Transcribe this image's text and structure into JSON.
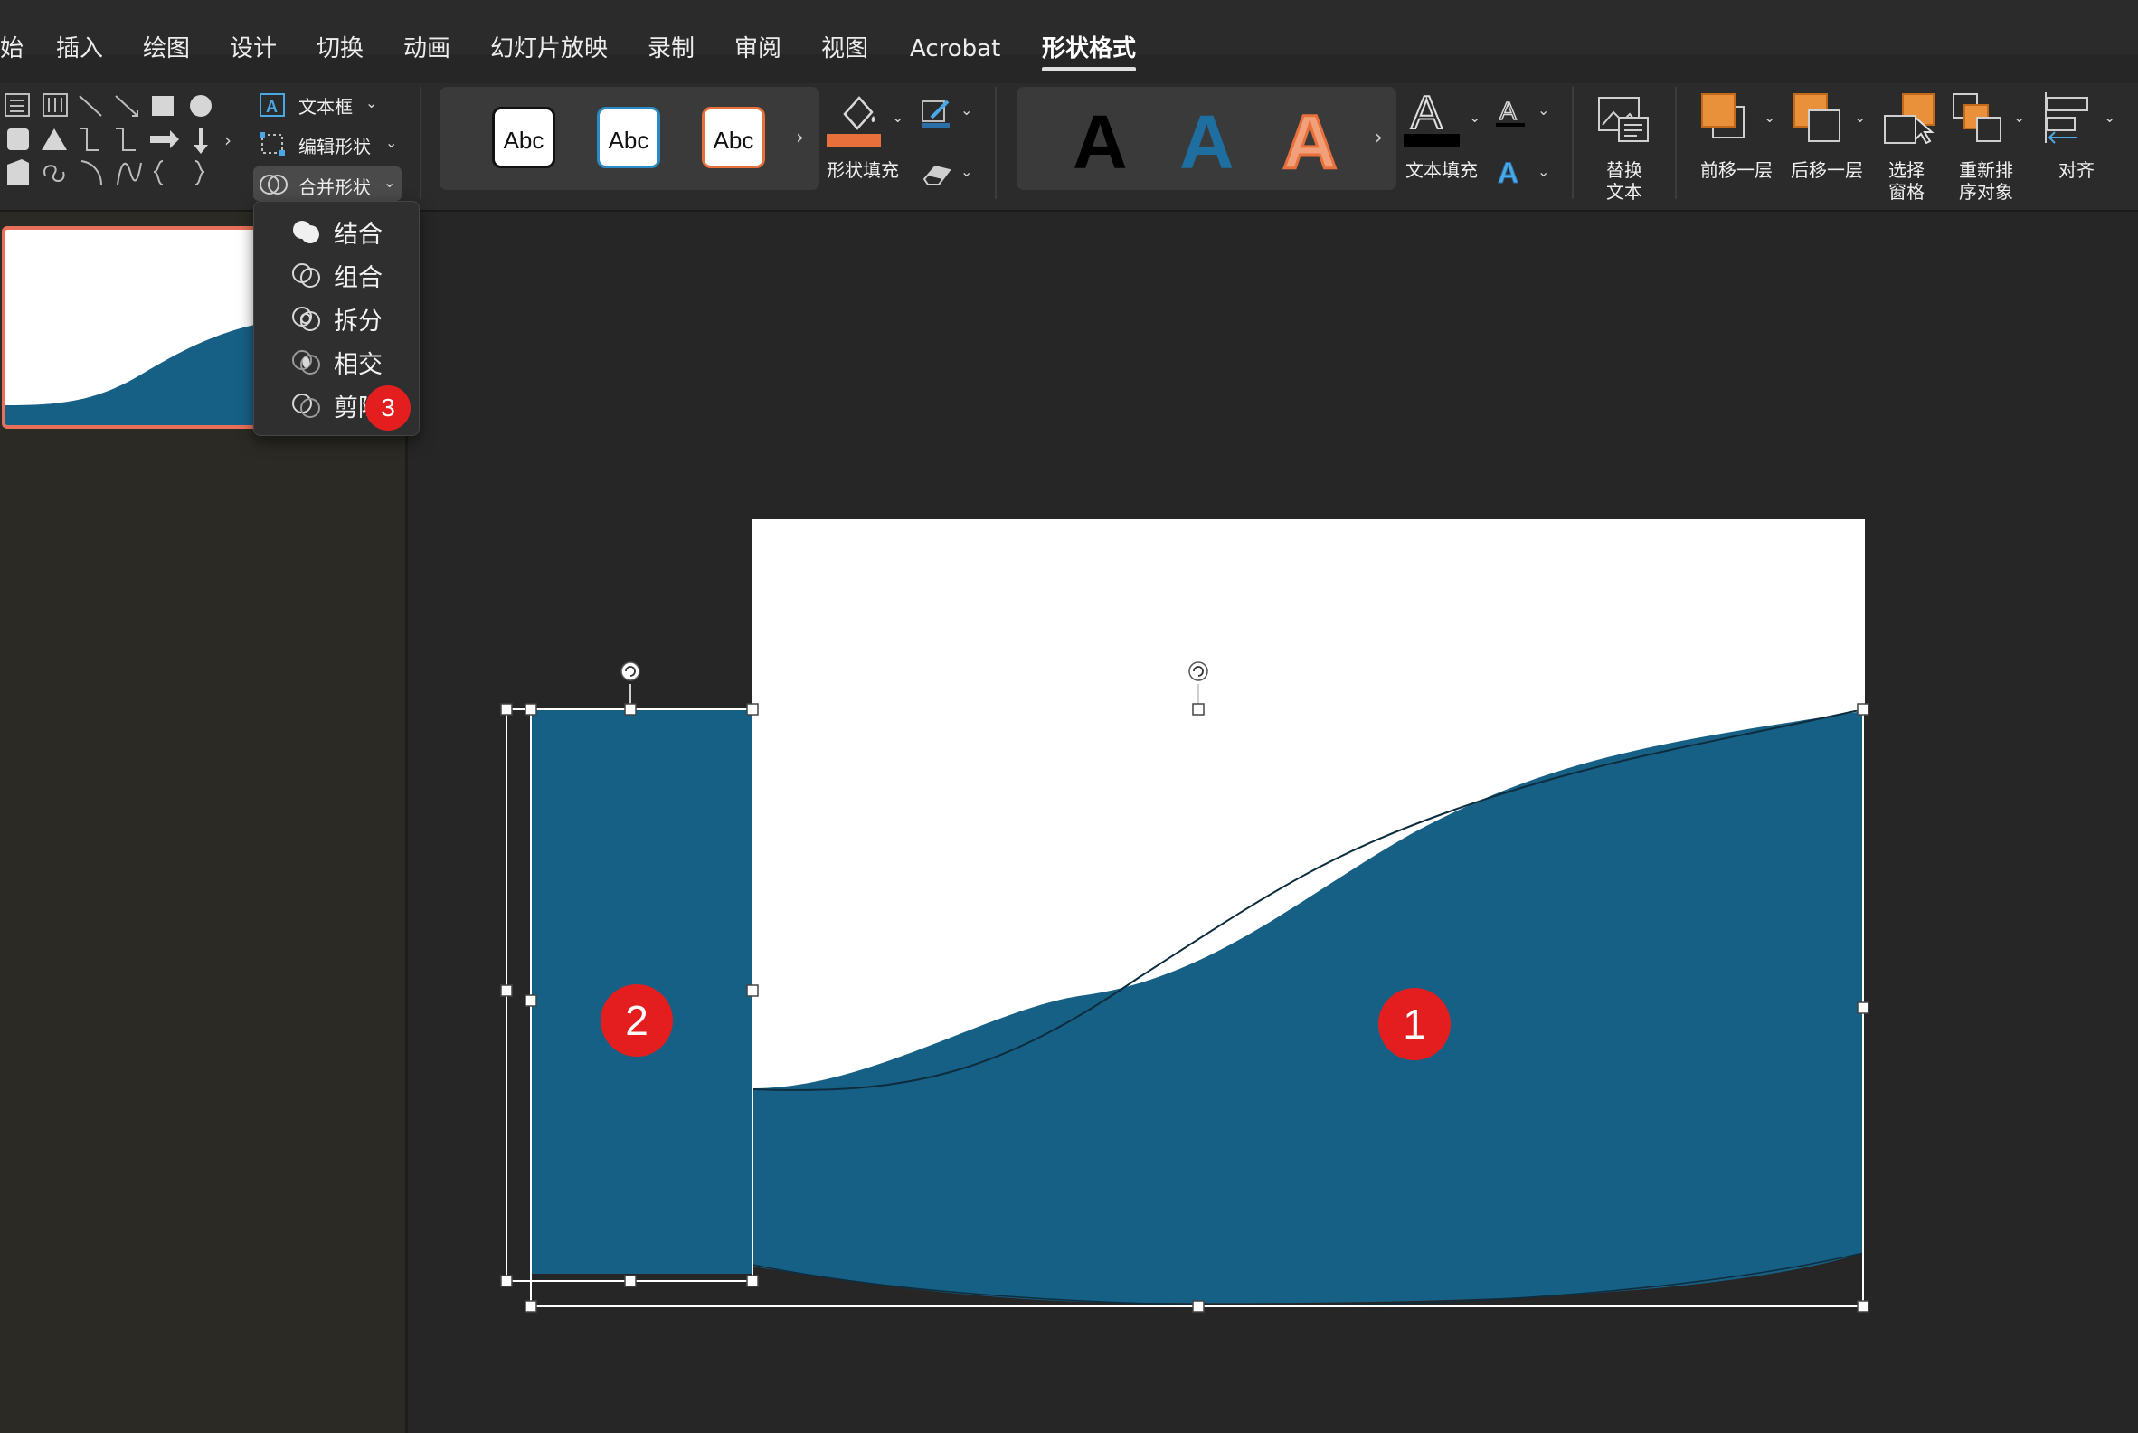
{
  "tabs": [
    {
      "label": "始",
      "active": false
    },
    {
      "label": "插入",
      "active": false
    },
    {
      "label": "绘图",
      "active": false
    },
    {
      "label": "设计",
      "active": false
    },
    {
      "label": "切换",
      "active": false
    },
    {
      "label": "动画",
      "active": false
    },
    {
      "label": "幻灯片放映",
      "active": false
    },
    {
      "label": "录制",
      "active": false
    },
    {
      "label": "审阅",
      "active": false
    },
    {
      "label": "视图",
      "active": false
    },
    {
      "label": "Acrobat",
      "active": false
    },
    {
      "label": "形状格式",
      "active": true
    }
  ],
  "ribbon": {
    "insert_shapes": {
      "text_box": "文本框",
      "edit_shape": "编辑形状",
      "merge_shapes": "合并形状"
    },
    "shape_styles": {
      "sample1": "Abc",
      "sample2": "Abc",
      "sample3": "Abc"
    },
    "shape_fill": "形状填充",
    "wordart": {
      "sample": "A"
    },
    "text_fill": "文本填充",
    "alt_text": {
      "line1": "替换",
      "line2": "文本"
    },
    "bring_forward": "前移一层",
    "send_backward": "后移一层",
    "selection_pane": {
      "line1": "选择",
      "line2": "窗格"
    },
    "reorder": {
      "line1": "重新排",
      "line2": "序对象"
    },
    "align": "对齐"
  },
  "merge_menu": {
    "items": [
      "结合",
      "组合",
      "拆分",
      "相交",
      "剪除"
    ]
  },
  "badges": {
    "one": "1",
    "two": "2",
    "three": "3"
  },
  "colors": {
    "shape_fill": "#176085",
    "accent_orange": "#e8903a",
    "badge_red": "#e41e1e",
    "thumbnail_border": "#e8705a"
  },
  "icons": [
    "text-box-icon",
    "edit-shape-icon",
    "merge-shapes-icon",
    "paint-bucket-icon",
    "pen-icon",
    "eraser-icon",
    "text-outline-icon",
    "text-effects-icon",
    "alt-text-icon",
    "bring-forward-icon",
    "send-backward-icon",
    "selection-pane-icon",
    "reorder-icon",
    "align-icon",
    "rotate-handle-icon"
  ]
}
